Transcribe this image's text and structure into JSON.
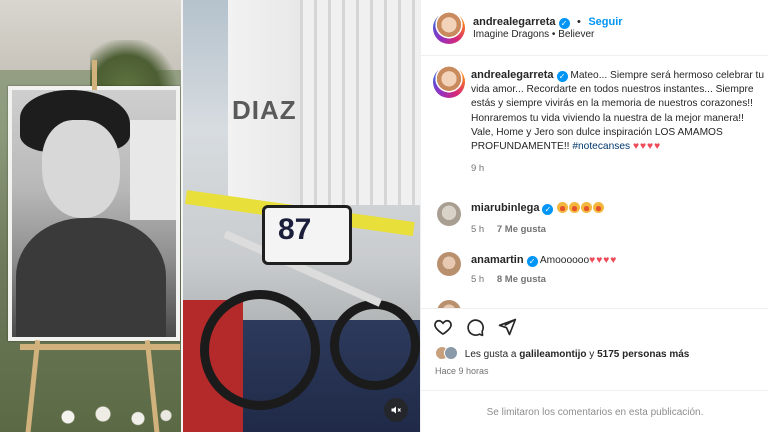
{
  "media": {
    "portrait_logo": "DIAZ",
    "bike_number": "87"
  },
  "header": {
    "username": "andrealegarreta",
    "follow_label": "Seguir",
    "song": "Imagine Dragons • Believer",
    "more_label": "•••"
  },
  "caption": {
    "username": "andrealegarreta",
    "text": "Mateo... Siempre será hermoso celebrar tu vida amor... Recordarte en todos nuestros instantes... Siempre estás y siempre vivirás en la memoria de nuestros corazones!! Honraremos tu vida viviendo la nuestra de la mejor manera!! Vale, Home y Jero son dulce inspiración LOS AMAMOS PROFUNDAMENTE!!",
    "hashtag": "#notecanses",
    "hearts": "♥♥♥♥",
    "time": "9 h"
  },
  "comments": [
    {
      "username": "miarubinlega",
      "text": "",
      "time": "5 h",
      "likes": "7 Me gusta"
    },
    {
      "username": "anamartin",
      "text": "Amoooooo",
      "hearts": "♥♥♥♥",
      "time": "5 h",
      "likes": "8 Me gusta"
    }
  ],
  "likes": {
    "prefix": "Les gusta a",
    "user": "galileamontijo",
    "middle": "y",
    "count": "5175 personas más"
  },
  "posted": "Hace 9 horas",
  "footer": "Se limitaron los comentarios en esta publicación.",
  "colors": {
    "accent": "#0095f6",
    "heart": "#ed4956",
    "muted": "#737373"
  }
}
